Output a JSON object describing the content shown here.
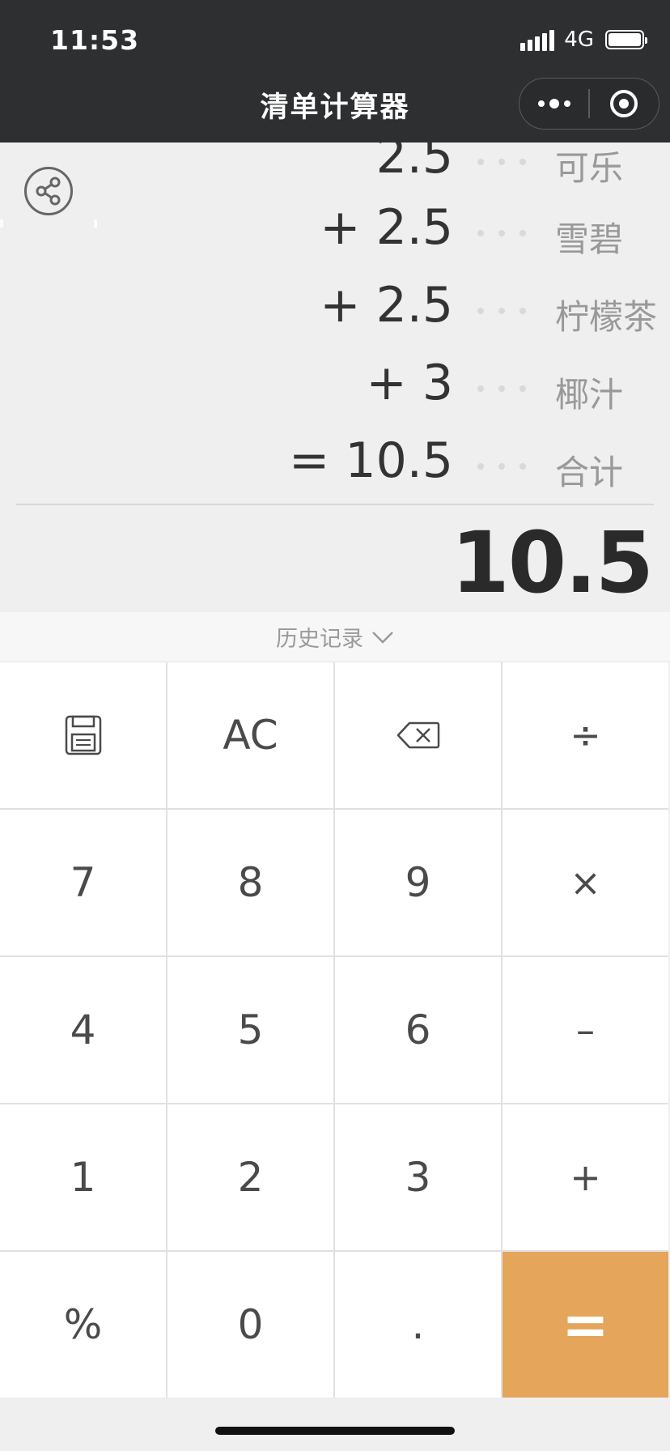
{
  "status": {
    "time": "11:53",
    "network": "4G"
  },
  "nav": {
    "title": "清单计算器"
  },
  "display": {
    "lines": [
      {
        "expr": "2.5",
        "label": "可乐"
      },
      {
        "expr": "+ 2.5",
        "label": "雪碧"
      },
      {
        "expr": "+ 2.5",
        "label": "柠檬茶"
      },
      {
        "expr": "+ 3",
        "label": "椰汁"
      },
      {
        "expr": "= 10.5",
        "label": "合计"
      }
    ],
    "result": "10.5"
  },
  "history": {
    "label": "历史记录"
  },
  "keys": {
    "save": "save-icon",
    "ac": "AC",
    "backspace": "backspace-icon",
    "divide": "÷",
    "k7": "7",
    "k8": "8",
    "k9": "9",
    "multiply": "×",
    "k4": "4",
    "k5": "5",
    "k6": "6",
    "minus": "–",
    "k1": "1",
    "k2": "2",
    "k3": "3",
    "plus": "+",
    "percent": "%",
    "k0": "0",
    "dot": ".",
    "equals": "="
  },
  "colors": {
    "nav_bg": "#2e2f31",
    "equals_bg": "#e5a55a",
    "display_bg": "#eeefee"
  }
}
